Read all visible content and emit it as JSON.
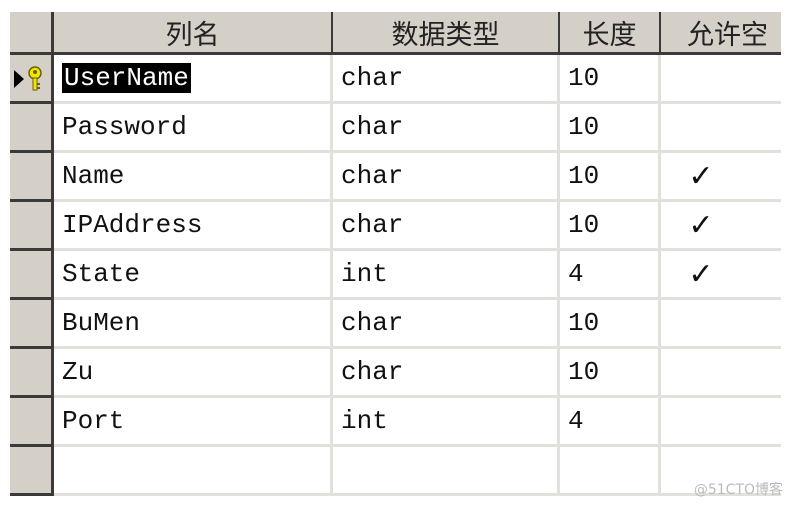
{
  "columns": [
    "列名",
    "数据类型",
    "长度",
    "允许空"
  ],
  "rows": [
    {
      "name": "UserName",
      "type": "char",
      "length": "10",
      "nullable": "",
      "primary_key": true,
      "selected": true
    },
    {
      "name": "Password",
      "type": "char",
      "length": "10",
      "nullable": ""
    },
    {
      "name": "Name",
      "type": "char",
      "length": "10",
      "nullable": "✓"
    },
    {
      "name": "IPAddress",
      "type": "char",
      "length": "10",
      "nullable": "✓"
    },
    {
      "name": "State",
      "type": "int",
      "length": "4",
      "nullable": "✓"
    },
    {
      "name": "BuMen",
      "type": "char",
      "length": "10",
      "nullable": ""
    },
    {
      "name": "Zu",
      "type": "char",
      "length": "10",
      "nullable": ""
    },
    {
      "name": "Port",
      "type": "int",
      "length": "4",
      "nullable": ""
    },
    {
      "name": "",
      "type": "",
      "length": "",
      "nullable": ""
    }
  ],
  "watermark": "@51CTO博客"
}
